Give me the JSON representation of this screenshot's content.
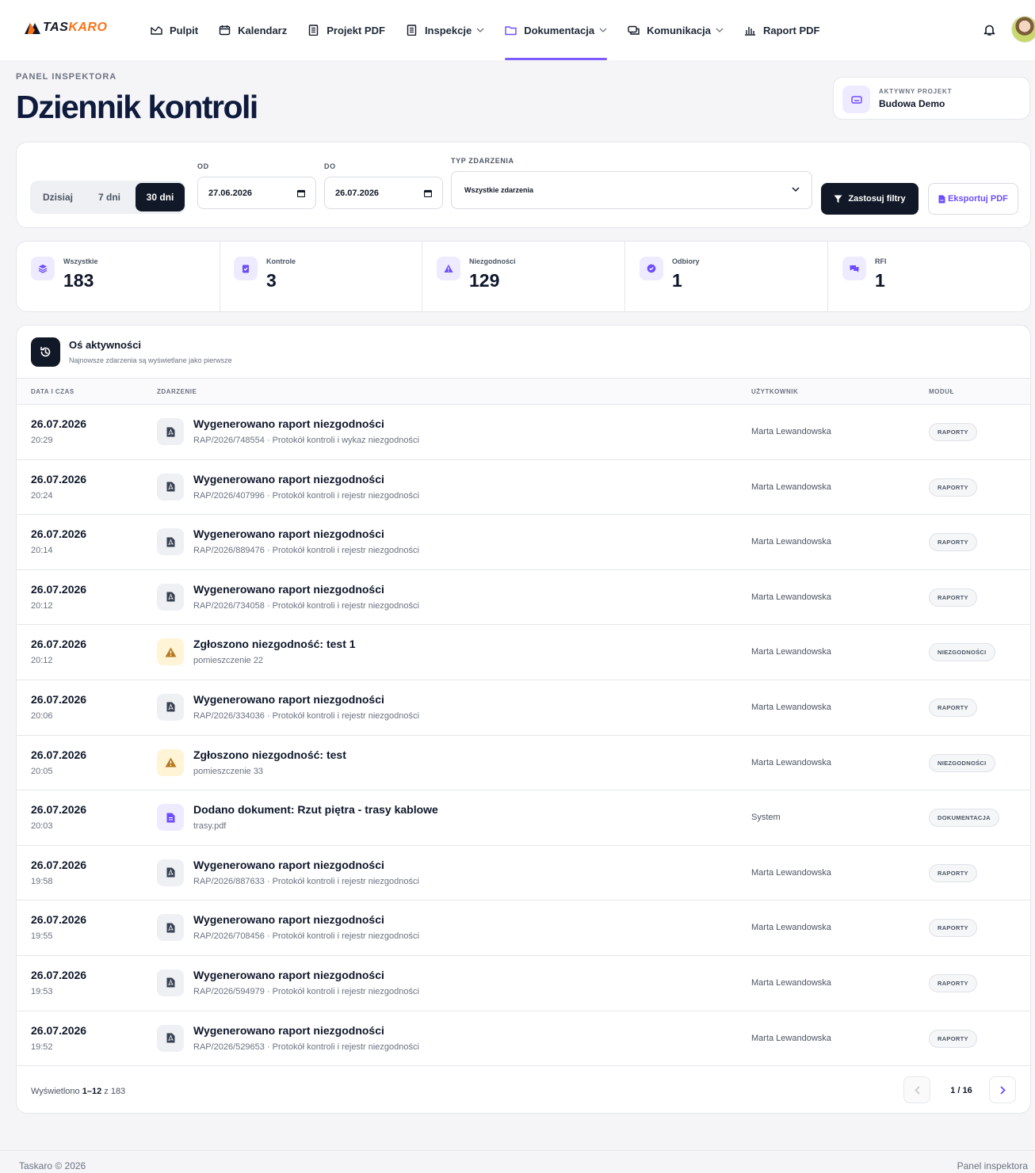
{
  "brand": {
    "name_part1": "TAS",
    "name_part2": "KARO",
    "accent": "#7c5cff",
    "logo_orange": "#f97316"
  },
  "nav": {
    "items": [
      {
        "label": "Pulpit",
        "icon": "chart-icon"
      },
      {
        "label": "Kalendarz",
        "icon": "calendar-icon"
      },
      {
        "label": "Projekt PDF",
        "icon": "document-icon"
      },
      {
        "label": "Inspekcje",
        "icon": "list-icon",
        "dropdown": true
      },
      {
        "label": "Dokumentacja",
        "icon": "folder-icon",
        "dropdown": true,
        "active": true
      },
      {
        "label": "Komunikacja",
        "icon": "chat-icon",
        "dropdown": true
      },
      {
        "label": "Raport PDF",
        "icon": "bar-chart-icon"
      }
    ]
  },
  "header": {
    "eyebrow": "PANEL INSPEKTORA",
    "title": "Dziennik kontroli",
    "project_label": "AKTYWNY PROJEKT",
    "project_name": "Budowa Demo"
  },
  "filters": {
    "range_options": [
      "Dzisiaj",
      "7 dni",
      "30 dni"
    ],
    "range_selected": "30 dni",
    "from_label": "OD",
    "from_value": "27.06.2026",
    "to_label": "DO",
    "to_value": "26.07.2026",
    "type_label": "TYP ZDARZENIA",
    "type_value": "Wszystkie zdarzenia",
    "apply_label": "Zastosuj filtry",
    "export_label": "Eksportuj PDF"
  },
  "stats": [
    {
      "label": "Wszystkie",
      "value": "183",
      "icon": "layers-icon"
    },
    {
      "label": "Kontrole",
      "value": "3",
      "icon": "clipboard-check-icon"
    },
    {
      "label": "Niezgodności",
      "value": "129",
      "icon": "warning-icon"
    },
    {
      "label": "Odbiory",
      "value": "1",
      "icon": "check-circle-icon"
    },
    {
      "label": "RFI",
      "value": "1",
      "icon": "chat-bubbles-icon"
    }
  ],
  "timeline": {
    "title": "Oś aktywności",
    "subtitle": "Najnowsze zdarzenia są wyświetlane jako pierwsze",
    "columns": [
      "DATA I CZAS",
      "ZDARZENIE",
      "UŻYTKOWNIK",
      "MODUŁ"
    ],
    "rows": [
      {
        "date": "26.07.2026",
        "time": "20:29",
        "icon": "pdf-icon",
        "title": "Wygenerowano raport niezgodności",
        "sub": "RAP/2026/748554 · Protokół kontroli i wykaz niezgodności",
        "user": "Marta Lewandowska",
        "module": "RAPORTY"
      },
      {
        "date": "26.07.2026",
        "time": "20:24",
        "icon": "pdf-icon",
        "title": "Wygenerowano raport niezgodności",
        "sub": "RAP/2026/407996 · Protokół kontroli i rejestr niezgodności",
        "user": "Marta Lewandowska",
        "module": "RAPORTY"
      },
      {
        "date": "26.07.2026",
        "time": "20:14",
        "icon": "pdf-icon",
        "title": "Wygenerowano raport niezgodności",
        "sub": "RAP/2026/889476 · Protokół kontroli i rejestr niezgodności",
        "user": "Marta Lewandowska",
        "module": "RAPORTY"
      },
      {
        "date": "26.07.2026",
        "time": "20:12",
        "icon": "pdf-icon",
        "title": "Wygenerowano raport niezgodności",
        "sub": "RAP/2026/734058 · Protokół kontroli i rejestr niezgodności",
        "user": "Marta Lewandowska",
        "module": "RAPORTY"
      },
      {
        "date": "26.07.2026",
        "time": "20:12",
        "icon": "warning-icon",
        "title": "Zgłoszono niezgodność: test 1",
        "sub": "pomieszczenie 22",
        "user": "Marta Lewandowska",
        "module": "NIEZGODNOŚCI"
      },
      {
        "date": "26.07.2026",
        "time": "20:06",
        "icon": "pdf-icon",
        "title": "Wygenerowano raport niezgodności",
        "sub": "RAP/2026/334036 · Protokół kontroli i rejestr niezgodności",
        "user": "Marta Lewandowska",
        "module": "RAPORTY"
      },
      {
        "date": "26.07.2026",
        "time": "20:05",
        "icon": "warning-icon",
        "title": "Zgłoszono niezgodność: test",
        "sub": "pomieszczenie 33",
        "user": "Marta Lewandowska",
        "module": "NIEZGODNOŚCI"
      },
      {
        "date": "26.07.2026",
        "time": "20:03",
        "icon": "document-icon",
        "title": "Dodano dokument: Rzut piętra - trasy kablowe",
        "sub": "trasy.pdf",
        "user": "System",
        "module": "DOKUMENTACJA"
      },
      {
        "date": "26.07.2026",
        "time": "19:58",
        "icon": "pdf-icon",
        "title": "Wygenerowano raport niezgodności",
        "sub": "RAP/2026/887633 · Protokół kontroli i rejestr niezgodności",
        "user": "Marta Lewandowska",
        "module": "RAPORTY"
      },
      {
        "date": "26.07.2026",
        "time": "19:55",
        "icon": "pdf-icon",
        "title": "Wygenerowano raport niezgodności",
        "sub": "RAP/2026/708456 · Protokół kontroli i rejestr niezgodności",
        "user": "Marta Lewandowska",
        "module": "RAPORTY"
      },
      {
        "date": "26.07.2026",
        "time": "19:53",
        "icon": "pdf-icon",
        "title": "Wygenerowano raport niezgodności",
        "sub": "RAP/2026/594979 · Protokół kontroli i rejestr niezgodności",
        "user": "Marta Lewandowska",
        "module": "RAPORTY"
      },
      {
        "date": "26.07.2026",
        "time": "19:52",
        "icon": "pdf-icon",
        "title": "Wygenerowano raport niezgodności",
        "sub": "RAP/2026/529653 · Protokół kontroli i rejestr niezgodności",
        "user": "Marta Lewandowska",
        "module": "RAPORTY"
      }
    ],
    "shown_prefix": "Wyświetlono",
    "shown_range": "1–12",
    "shown_suffix": "z 183",
    "page_info": "1 / 16"
  },
  "footer": {
    "left": "Taskaro © 2026",
    "right": "Panel inspektora"
  }
}
